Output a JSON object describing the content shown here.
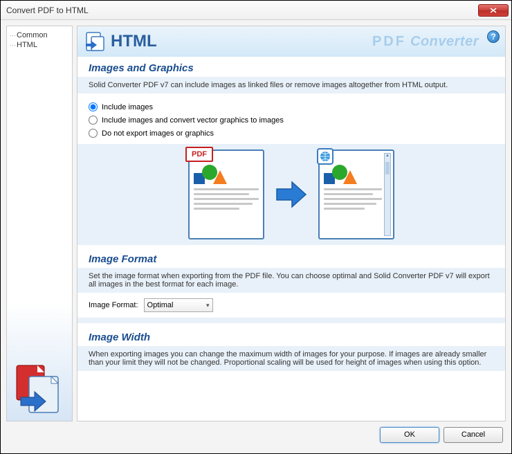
{
  "window": {
    "title": "Convert PDF to HTML"
  },
  "sidebar": {
    "items": [
      {
        "label": "Common"
      },
      {
        "label": "HTML"
      }
    ]
  },
  "header": {
    "title": "HTML",
    "brand_pdf": "PDF",
    "brand_conv": "Converter"
  },
  "sections": {
    "images": {
      "title": "Images and Graphics",
      "desc": "Solid Converter PDF v7 can include images as linked files or remove images altogether from HTML output.",
      "options": [
        "Include images",
        "Include images and convert vector graphics to images",
        "Do not export  images or graphics"
      ],
      "badge_pdf": "PDF"
    },
    "format": {
      "title": "Image Format",
      "desc": "Set the image format when exporting from the PDF file. You can choose optimal and Solid Converter PDF v7 will export all images in the best format for each image.",
      "label": "Image Format:",
      "value": "Optimal"
    },
    "width": {
      "title": "Image Width",
      "desc": "When exporting images you can change the maximum width of images for your purpose. If images are already smaller than your limit they will not be changed. Proportional scaling will be used for height of images when using this option."
    }
  },
  "buttons": {
    "ok": "OK",
    "cancel": "Cancel"
  }
}
